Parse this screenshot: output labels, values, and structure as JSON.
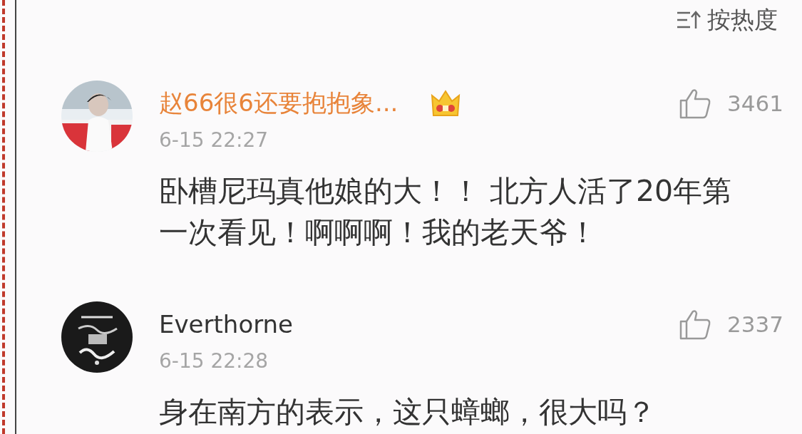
{
  "sort": {
    "label": "按热度"
  },
  "comments": [
    {
      "name": "赵66很6还要抱抱象...",
      "vip": true,
      "likes": "3461",
      "time": "6-15 22:27",
      "text": "卧槽尼玛真他娘的大！！ 北方人活了20年第一次看见！啊啊啊！我的老天爷！"
    },
    {
      "name": "Everthorne",
      "vip": false,
      "likes": "2337",
      "time": "6-15 22:28",
      "text": "身在南方的表示，这只蟑螂，很大吗？"
    }
  ]
}
